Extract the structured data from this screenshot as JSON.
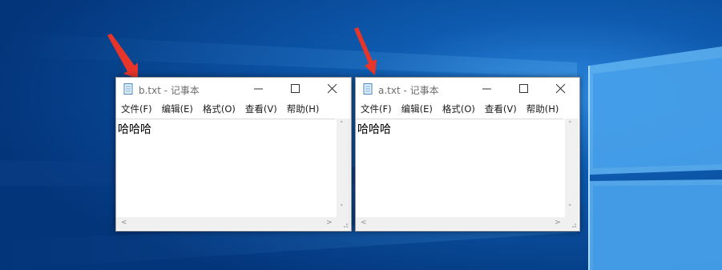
{
  "windows": [
    {
      "id": "b",
      "title": "b.txt - 记事本",
      "menu": [
        "文件(F)",
        "编辑(E)",
        "格式(O)",
        "查看(V)",
        "帮助(H)"
      ],
      "content": "哈哈哈",
      "icon": "notepad-icon"
    },
    {
      "id": "a",
      "title": "a.txt - 记事本",
      "menu": [
        "文件(F)",
        "编辑(E)",
        "格式(O)",
        "查看(V)",
        "帮助(H)"
      ],
      "content": "哈哈哈",
      "icon": "notepad-icon"
    }
  ],
  "colors": {
    "desktop_bg": "#0a4a94",
    "annotation_arrow": "#e8352a",
    "title_text": "#6d6d6d"
  }
}
